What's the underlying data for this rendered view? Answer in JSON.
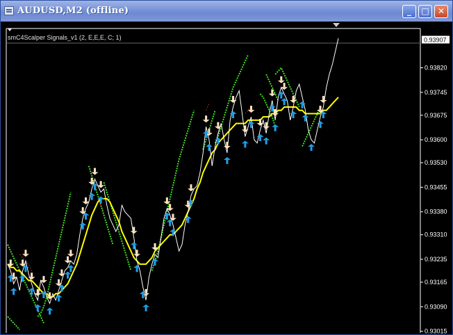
{
  "window": {
    "title": "AUDUSD,M2 (offline)",
    "controls": {
      "minimize": "_",
      "maximize": "□",
      "close": "✕"
    }
  },
  "indicator": {
    "label": "smC4Scalper Signals_v1 (2, E,E,E, C; 1)"
  },
  "colors": {
    "background": "#000000",
    "price": "#ffffff",
    "moving_average": "#ffff00",
    "band": "#44dd22",
    "sell_arrow": "#ffe4c4",
    "buy_arrow": "#1e9fe8",
    "dashed_line": "#cc2222"
  },
  "current_price": "0.93907",
  "chart_data": {
    "type": "line",
    "ylim": [
      0.9301,
      0.9394
    ],
    "price_axis": [
      "0.93820",
      "0.93745",
      "0.93675",
      "0.93600",
      "0.93530",
      "0.93455",
      "0.93380",
      "0.93310",
      "0.93235",
      "0.93165",
      "0.93090",
      "0.93015"
    ],
    "price_series": [
      0.9322,
      0.932,
      0.9316,
      0.9318,
      0.9314,
      0.932,
      0.9323,
      0.9319,
      0.9316,
      0.9313,
      0.9311,
      0.9317,
      0.9315,
      0.9312,
      0.931,
      0.9313,
      0.9311,
      0.9314,
      0.9317,
      0.932,
      0.9321,
      0.9323,
      0.9322,
      0.9325,
      0.9331,
      0.9336,
      0.9339,
      0.9341,
      0.9345,
      0.9348,
      0.9346,
      0.9344,
      0.9345,
      0.934,
      0.9336,
      0.9334,
      0.9332,
      0.9334,
      0.934,
      0.9338,
      0.9337,
      0.9336,
      0.933,
      0.9323,
      0.932,
      0.9315,
      0.9311,
      0.9318,
      0.9322,
      0.9325,
      0.9324,
      0.933,
      0.9336,
      0.9339,
      0.9337,
      0.9334,
      0.933,
      0.9326,
      0.9328,
      0.9334,
      0.9338,
      0.9343,
      0.9345,
      0.9346,
      0.935,
      0.9356,
      0.9364,
      0.936,
      0.9352,
      0.9358,
      0.9362,
      0.9365,
      0.936,
      0.9356,
      0.9366,
      0.937,
      0.9373,
      0.9375,
      0.9368,
      0.9361,
      0.9364,
      0.9367,
      0.936,
      0.9359,
      0.9363,
      0.9366,
      0.9362,
      0.9368,
      0.9372,
      0.9366,
      0.9373,
      0.9376,
      0.9374,
      0.9372,
      0.9366,
      0.937,
      0.9375,
      0.9377,
      0.9373,
      0.9369,
      0.9363,
      0.936,
      0.9359,
      0.9363,
      0.9367,
      0.937,
      0.9376,
      0.938,
      0.9383,
      0.9387,
      0.9391
    ],
    "ma_series": [
      0.9322,
      0.9321,
      0.9321,
      0.932,
      0.932,
      0.9319,
      0.9318,
      0.9317,
      0.9317,
      0.9316,
      0.9315,
      0.9314,
      0.9313,
      0.9313,
      0.9312,
      0.9312,
      0.9313,
      0.9313,
      0.9314,
      0.9315,
      0.9316,
      0.9318,
      0.932,
      0.9322,
      0.9325,
      0.9328,
      0.9331,
      0.9334,
      0.9337,
      0.9339,
      0.9341,
      0.9342,
      0.9342,
      0.9342,
      0.9341,
      0.9339,
      0.9337,
      0.9335,
      0.9332,
      0.933,
      0.9328,
      0.9326,
      0.9324,
      0.9323,
      0.9322,
      0.9322,
      0.9322,
      0.9323,
      0.9324,
      0.9326,
      0.9327,
      0.9328,
      0.9329,
      0.933,
      0.9331,
      0.9331,
      0.9332,
      0.9333,
      0.9334,
      0.9336,
      0.9338,
      0.934,
      0.9342,
      0.9345,
      0.9347,
      0.935,
      0.9352,
      0.9354,
      0.9356,
      0.9357,
      0.9359,
      0.936,
      0.9361,
      0.9362,
      0.9363,
      0.9364,
      0.9365,
      0.9365,
      0.9365,
      0.9365,
      0.9366,
      0.9366,
      0.9366,
      0.9366,
      0.9366,
      0.9367,
      0.9367,
      0.9367,
      0.9368,
      0.9368,
      0.9369,
      0.9369,
      0.937,
      0.937,
      0.937,
      0.937,
      0.937,
      0.9369,
      0.9369,
      0.9368,
      0.9368,
      0.9368,
      0.9368,
      0.9368,
      0.9368,
      0.9369,
      0.9369,
      0.937,
      0.9371,
      0.9372,
      0.9373
    ],
    "band_segments": [
      {
        "start": 0,
        "values": [
          0.9328,
          0.9326,
          0.9324,
          0.9322,
          0.932,
          0.9318,
          0.9316,
          0.9314,
          0.9312,
          0.931,
          0.9308,
          0.9306,
          0.9304
        ]
      },
      {
        "start": 0,
        "values": [
          0.9306,
          0.9305,
          0.9304,
          0.9303,
          0.9302
        ]
      },
      {
        "start": 10,
        "values": [
          0.9306,
          0.9307,
          0.9309,
          0.9312,
          0.9316,
          0.932,
          0.9324,
          0.9328,
          0.9332,
          0.9336,
          0.934,
          0.9344
        ]
      },
      {
        "start": 27,
        "values": [
          0.9352,
          0.9349,
          0.9346,
          0.9343,
          0.934,
          0.9337,
          0.9334,
          0.9331,
          0.9328
        ]
      },
      {
        "start": 32,
        "values": [
          0.9347,
          0.9344,
          0.9341,
          0.9338,
          0.9335,
          0.9332,
          0.9329,
          0.9326,
          0.9323,
          0.932
        ]
      },
      {
        "start": 48,
        "values": [
          0.932,
          0.9323,
          0.9326,
          0.933,
          0.9334,
          0.9338,
          0.9342,
          0.9346,
          0.935,
          0.9354,
          0.9357,
          0.936,
          0.9363,
          0.9366,
          0.9369
        ]
      },
      {
        "start": 65,
        "values": [
          0.9357,
          0.936,
          0.9363,
          0.9366,
          0.9369
        ]
      },
      {
        "start": 69,
        "values": [
          0.9359,
          0.9361,
          0.9364,
          0.9367,
          0.937,
          0.9373,
          0.9376,
          0.9378,
          0.938,
          0.9382,
          0.9384,
          0.9386
        ]
      },
      {
        "start": 84,
        "values": [
          0.9374,
          0.9373,
          0.9371,
          0.9369,
          0.9367,
          0.9364
        ]
      },
      {
        "start": 86,
        "values": [
          0.938,
          0.9378,
          0.9376,
          0.9374,
          0.9372
        ]
      },
      {
        "start": 89,
        "values": [
          0.938,
          0.9381,
          0.9382,
          0.938,
          0.9378,
          0.9376,
          0.9374,
          0.9372,
          0.937
        ]
      },
      {
        "start": 98,
        "values": [
          0.9358,
          0.936,
          0.9362,
          0.9364,
          0.9366,
          0.9368,
          0.937
        ]
      }
    ],
    "dashed_segments": [
      {
        "start": 4,
        "values": [
          0.9325,
          0.9324,
          0.9323,
          0.9322,
          0.932
        ]
      },
      {
        "start": 30,
        "values": [
          0.9342,
          0.934,
          0.9338
        ]
      },
      {
        "start": 66,
        "values": [
          0.9369,
          0.9371
        ]
      },
      {
        "start": 79,
        "values": [
          0.9368,
          0.9369,
          0.937
        ]
      }
    ],
    "sell_arrows": [
      1,
      2,
      5,
      6,
      8,
      10,
      12,
      14,
      17,
      18,
      20,
      21,
      25,
      26,
      28,
      29,
      31,
      42,
      43,
      46,
      49,
      53,
      54,
      55,
      60,
      61,
      66,
      67,
      70,
      73,
      75,
      79,
      81,
      84,
      86,
      88,
      89,
      91,
      92,
      95,
      104,
      105
    ],
    "buy_arrows": [
      1,
      2,
      5,
      6,
      8,
      10,
      12,
      14,
      17,
      18,
      20,
      21,
      25,
      26,
      28,
      29,
      31,
      42,
      43,
      45,
      46,
      49,
      53,
      54,
      55,
      60,
      61,
      66,
      67,
      70,
      73,
      75,
      79,
      81,
      84,
      86,
      88,
      89,
      91,
      92,
      95,
      98,
      99,
      101,
      104,
      105
    ]
  }
}
